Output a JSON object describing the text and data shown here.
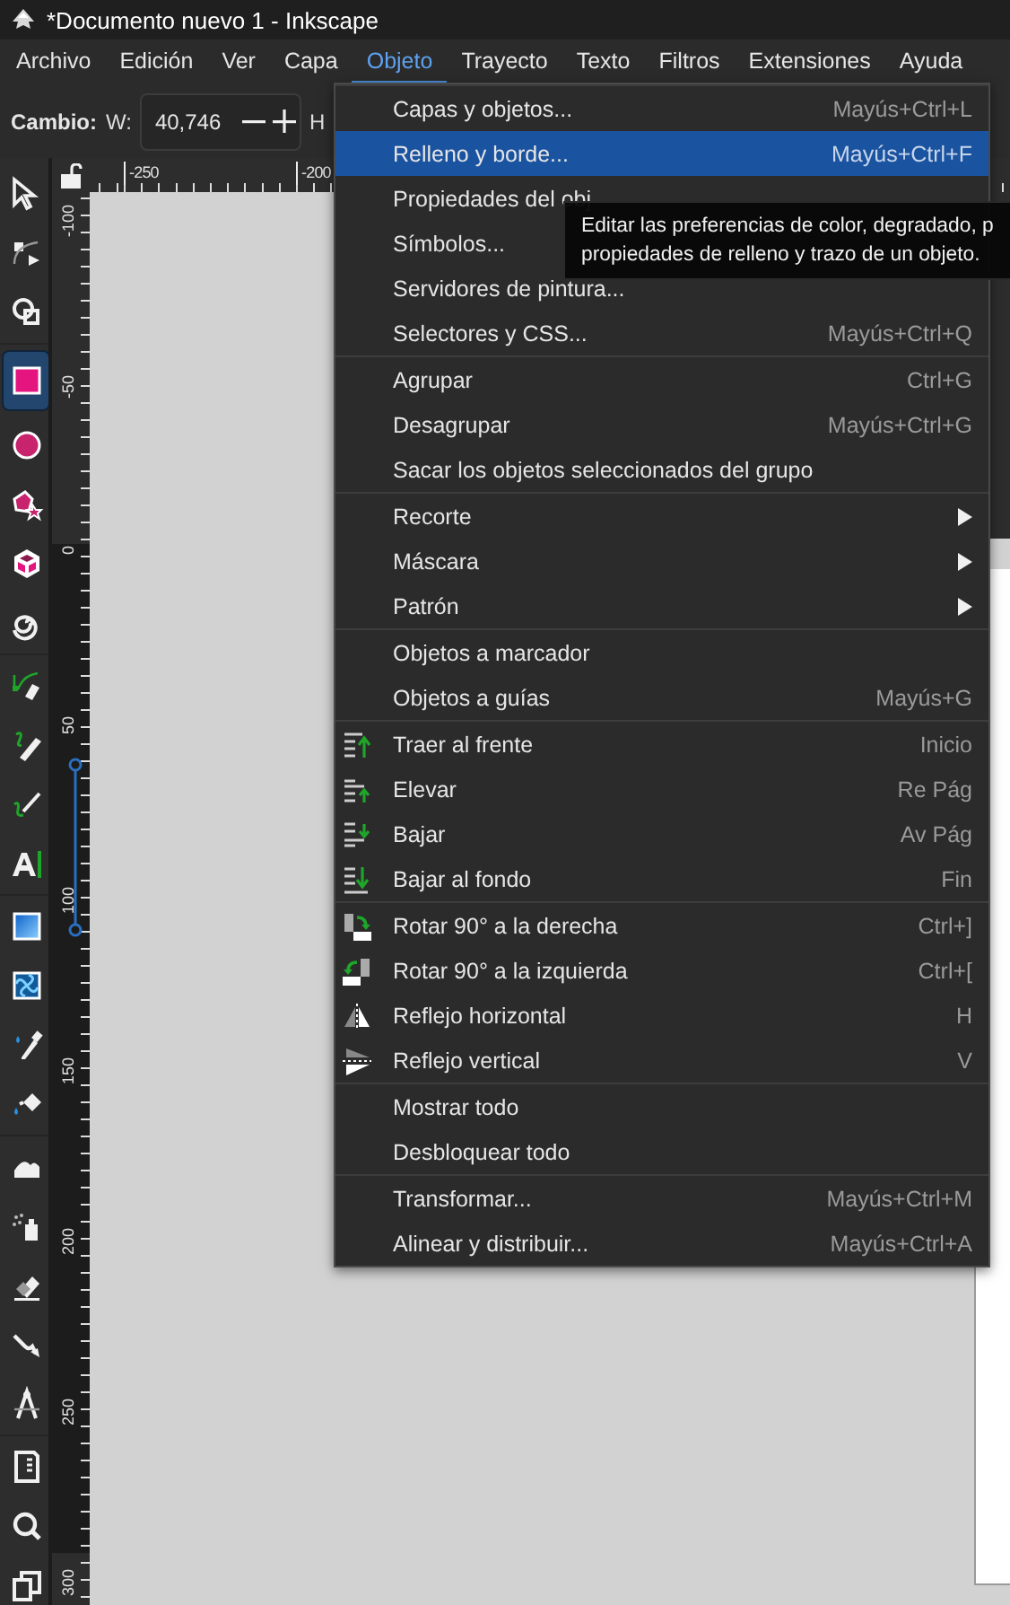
{
  "window": {
    "title": "*Documento nuevo 1 - Inkscape"
  },
  "menubar": [
    {
      "label": "Archivo",
      "selected": false
    },
    {
      "label": "Edición",
      "selected": false
    },
    {
      "label": "Ver",
      "selected": false
    },
    {
      "label": "Capa",
      "selected": false
    },
    {
      "label": "Objeto",
      "selected": true
    },
    {
      "label": "Trayecto",
      "selected": false
    },
    {
      "label": "Texto",
      "selected": false
    },
    {
      "label": "Filtros",
      "selected": false
    },
    {
      "label": "Extensiones",
      "selected": false
    },
    {
      "label": "Ayuda",
      "selected": false
    }
  ],
  "toolbar": {
    "label": "Cambio:",
    "fields": [
      {
        "label": "W:",
        "value": "40,746"
      },
      {
        "label": "H"
      }
    ]
  },
  "toolbox": {
    "groups": [
      [
        {
          "selected": false
        },
        {
          "selected": false
        },
        {
          "selected": false
        }
      ],
      [
        {
          "selected": true
        },
        {
          "selected": false
        },
        {
          "selected": false
        },
        {
          "selected": false
        },
        {
          "selected": false
        }
      ],
      [
        {
          "selected": false
        },
        {
          "selected": false
        },
        {
          "selected": false
        },
        {
          "selected": false
        }
      ],
      [
        {
          "selected": false
        },
        {
          "selected": false
        },
        {
          "selected": false
        },
        {
          "selected": false
        }
      ],
      [
        {
          "selected": false
        },
        {
          "selected": false
        },
        {
          "selected": false
        },
        {
          "selected": false
        },
        {
          "selected": false
        }
      ],
      [
        {
          "selected": false
        },
        {
          "selected": false
        },
        {
          "selected": false
        }
      ]
    ]
  },
  "rulers": {
    "horizontal": [
      "-250",
      "-200"
    ],
    "vertical": [
      "-100",
      "-50",
      "0",
      "50",
      "100",
      "150",
      "200",
      "250",
      "300"
    ]
  },
  "menu": {
    "groups": [
      [
        {
          "kind": "plain",
          "label": "Capas y objetos...",
          "shortcut": "Mayús+Ctrl+L",
          "selected": false
        },
        {
          "kind": "plain",
          "label": "Relleno y borde...",
          "shortcut": "Mayús+Ctrl+F",
          "selected": true
        },
        {
          "kind": "plain",
          "label": "Propiedades del obj",
          "selected": false
        },
        {
          "kind": "plain",
          "label": "Símbolos...",
          "selected": false
        },
        {
          "kind": "plain",
          "label": "Servidores de pintura...",
          "selected": false
        },
        {
          "kind": "plain",
          "label": "Selectores y CSS...",
          "shortcut": "Mayús+Ctrl+Q",
          "selected": false
        }
      ],
      [
        {
          "kind": "plain",
          "label": "Agrupar",
          "shortcut": "Ctrl+G",
          "selected": false
        },
        {
          "kind": "plain",
          "label": "Desagrupar",
          "shortcut": "Mayús+Ctrl+G",
          "selected": false
        },
        {
          "kind": "plain",
          "label": "Sacar los objetos seleccionados del grupo",
          "selected": false
        }
      ],
      [
        {
          "kind": "submenu",
          "label": "Recorte",
          "selected": false
        },
        {
          "kind": "submenu",
          "label": "Máscara",
          "selected": false
        },
        {
          "kind": "submenu",
          "label": "Patrón",
          "selected": false
        }
      ],
      [
        {
          "kind": "plain",
          "label": "Objetos a marcador",
          "selected": false
        },
        {
          "kind": "plain",
          "label": "Objetos a guías",
          "shortcut": "Mayús+G",
          "selected": false
        }
      ],
      [
        {
          "kind": "icon",
          "label": "Traer al frente",
          "shortcut": "Inicio",
          "selected": false
        },
        {
          "kind": "icon",
          "label": "Elevar",
          "shortcut": "Re Pág",
          "selected": false
        },
        {
          "kind": "icon",
          "label": "Bajar",
          "shortcut": "Av Pág",
          "selected": false
        },
        {
          "kind": "icon",
          "label": "Bajar al fondo",
          "shortcut": "Fin",
          "selected": false
        }
      ],
      [
        {
          "kind": "icon",
          "label": "Rotar 90° a la derecha",
          "shortcut": "Ctrl+]",
          "selected": false
        },
        {
          "kind": "icon",
          "label": "Rotar 90° a la izquierda",
          "shortcut": "Ctrl+[",
          "selected": false
        },
        {
          "kind": "icon",
          "label": "Reflejo horizontal",
          "shortcut": "H",
          "selected": false
        },
        {
          "kind": "icon",
          "label": "Reflejo vertical",
          "shortcut": "V",
          "selected": false
        }
      ],
      [
        {
          "kind": "plain",
          "label": "Mostrar todo",
          "selected": false
        },
        {
          "kind": "plain",
          "label": "Desbloquear todo",
          "selected": false
        }
      ],
      [
        {
          "kind": "plain",
          "label": "Transformar...",
          "shortcut": "Mayús+Ctrl+M",
          "selected": false
        },
        {
          "kind": "plain",
          "label": "Alinear y distribuir...",
          "shortcut": "Mayús+Ctrl+A",
          "selected": false
        }
      ]
    ]
  },
  "tooltip": {
    "lines": [
      "Editar las preferencias de color, degradado, p",
      "propiedades de relleno y trazo de un objeto."
    ]
  }
}
